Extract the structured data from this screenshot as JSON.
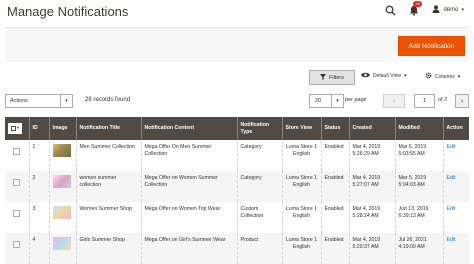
{
  "header": {
    "title": "Manage Notifications",
    "notification_count": "29",
    "user_name": "demo"
  },
  "action_bar": {
    "add_button_label": "Add Notification"
  },
  "toolbar": {
    "filters_label": "Filters",
    "view_label": "Default View",
    "columns_label": "Columns",
    "actions_label": "Actions",
    "records_found": "28 records found",
    "per_page_value": "20",
    "per_page_label": "per page",
    "current_page": "1",
    "page_of": "of 2"
  },
  "grid": {
    "columns": [
      "ID",
      "Image",
      "Notification Title",
      "Notification Content",
      "Notification Type",
      "Store View",
      "Status",
      "Created",
      "Modified",
      "Action"
    ],
    "rows": [
      {
        "id": "1",
        "title": "Men Summer Collection",
        "content": "Mega Offer On Men Summer Collection",
        "type": "Category",
        "store_view": "Luma Store 1 English",
        "status": "Enabled",
        "created": "Mar 4, 2019 5:26:29 AM",
        "modified": "Mar 5, 2019 5:03:55 AM",
        "action": "Edit"
      },
      {
        "id": "2",
        "title": "women summer collection",
        "content": "Mega Offer on Women Summer Collection",
        "type": "Category",
        "store_view": "Luma Store 1 English",
        "status": "Enabled",
        "created": "Mar 4, 2019 5:27:07 AM",
        "modified": "Mar 5, 2019 5:04:03 AM",
        "action": "Edit"
      },
      {
        "id": "3",
        "title": "Women Summer Shop",
        "content": "Mega Offer on Women Top Wear",
        "type": "Custom Collection",
        "store_view": "Luma Store 1 English",
        "status": "Enabled",
        "created": "Mar 4, 2019 5:28:24 AM",
        "modified": "Jun 13, 2019 6:39:13 AM",
        "action": "Edit"
      },
      {
        "id": "4",
        "title": "Girls Summer Shop",
        "content": "Mega Offer on Girl's Summer Wear",
        "type": "Product",
        "store_view": "Luma Store 1 English",
        "status": "Enabled",
        "created": "Mar 4, 2019 5:29:37 AM",
        "modified": "Jul 26, 2021 4:19:00 AM",
        "action": "Edit"
      }
    ]
  },
  "colors": {
    "accent": "#eb5202",
    "grid_header": "#514943",
    "link": "#007bdb",
    "badge": "#e22626"
  },
  "icons": {
    "search": "search-icon",
    "notifications": "bell-icon",
    "user": "user-icon",
    "filter": "filter-icon",
    "view": "eye-icon",
    "columns": "gear-icon"
  }
}
